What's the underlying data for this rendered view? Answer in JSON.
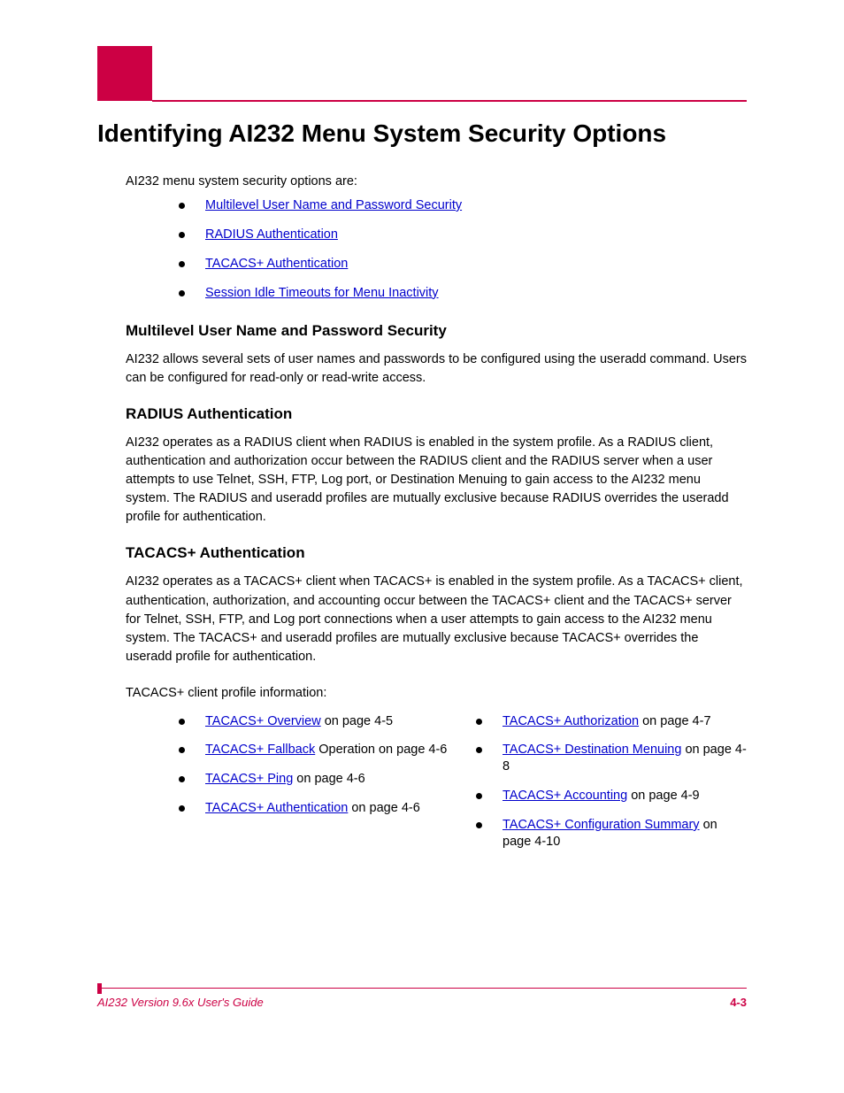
{
  "title": "Identifying AI232 Menu System Security Options",
  "intro": "AI232 menu system security options are:",
  "top_links": [
    {
      "text": "Multilevel User Name and Password Security",
      "tail": ""
    },
    {
      "text": "RADIUS Authentication",
      "tail": ""
    },
    {
      "text": "TACACS+ Authentication",
      "tail": ""
    },
    {
      "text": "Session Idle Timeouts for Menu Inactivity",
      "tail": ""
    }
  ],
  "sections": [
    {
      "heading": "Multilevel User Name and Password Security",
      "body": "AI232 allows several sets of user names and passwords to be configured using the useradd command. Users can be configured for read-only or read-write access."
    },
    {
      "heading": "RADIUS Authentication",
      "body": "AI232 operates as a RADIUS client when RADIUS is enabled in the system profile. As a RADIUS client, authentication and authorization occur between the RADIUS client and the RADIUS server when a user attempts to use Telnet, SSH, FTP, Log port, or Destination Menuing to gain access to the AI232 menu system. The RADIUS and useradd profiles are mutually exclusive because RADIUS overrides the useradd profile for authentication."
    },
    {
      "heading": "TACACS+ Authentication",
      "body": "AI232 operates as a TACACS+ client when TACACS+ is enabled in the system profile. As a TACACS+ client, authentication, authorization, and accounting occur between the TACACS+ client and the TACACS+ server for Telnet, SSH, FTP, and Log port connections when a user attempts to gain access to the AI232 menu system. The TACACS+ and useradd profiles are mutually exclusive because TACACS+ overrides the useradd profile for authentication."
    }
  ],
  "tac_sub_intro": "TACACS+ client profile information:",
  "tac_links_left": [
    {
      "text": "TACACS+ Overview",
      "tail": " on page 4-5"
    },
    {
      "text": "TACACS+ Fallback",
      "tail": " Operation on page 4-6"
    },
    {
      "text": "TACACS+ Ping",
      "tail": " on page 4-6"
    },
    {
      "text": "TACACS+ Authentication",
      "tail": " on page 4-6"
    }
  ],
  "tac_links_right": [
    {
      "text": "TACACS+ Authorization",
      "tail": " on page 4-7"
    },
    {
      "text": "TACACS+ Destination Menuing",
      "tail": " on page 4-8"
    },
    {
      "text": "TACACS+ Accounting",
      "tail": " on page 4-9"
    },
    {
      "text": "TACACS+ Configuration Summary",
      "tail": " on page 4-10"
    }
  ],
  "footer": {
    "left": "AI232 Version 9.6x User's Guide",
    "right": "4-3"
  }
}
